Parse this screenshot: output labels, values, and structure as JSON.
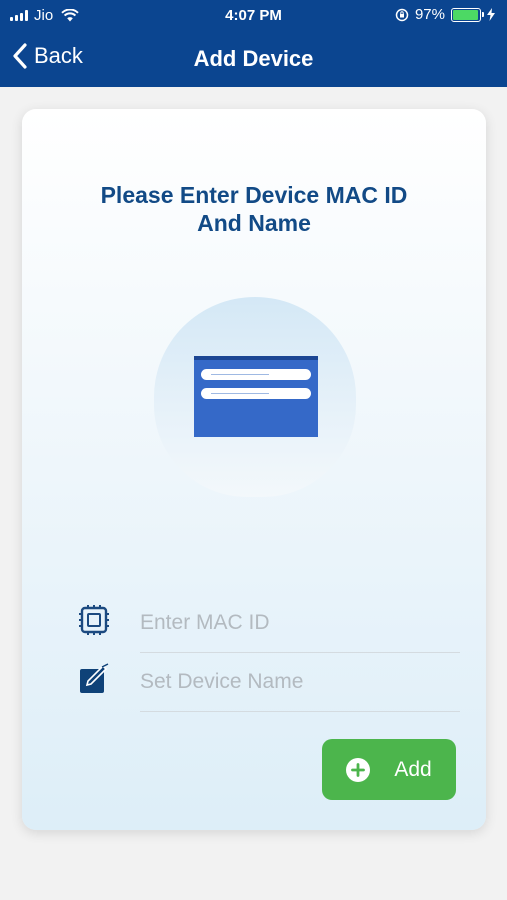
{
  "status_bar": {
    "carrier": "Jio",
    "time": "4:07 PM",
    "battery_percent": "97%",
    "battery_level": 0.97,
    "icons": [
      "signal-icon",
      "wifi-icon",
      "orientation-lock-icon",
      "battery-icon",
      "charging-icon"
    ]
  },
  "nav": {
    "back_label": "Back",
    "title": "Add Device"
  },
  "card": {
    "heading_line1": "Please Enter Device MAC ID",
    "heading_line2": "And Name"
  },
  "form": {
    "mac_placeholder": "Enter MAC ID",
    "mac_value": "",
    "name_placeholder": "Set Device Name",
    "name_value": "",
    "mac_icon": "chip-icon",
    "name_icon": "edit-icon"
  },
  "add_button": {
    "label": "Add",
    "icon": "plus-circle-icon"
  },
  "colors": {
    "header": "#0b4590",
    "heading_text": "#124a86",
    "add_button": "#4cb54c",
    "illustration": "#3569c8"
  }
}
